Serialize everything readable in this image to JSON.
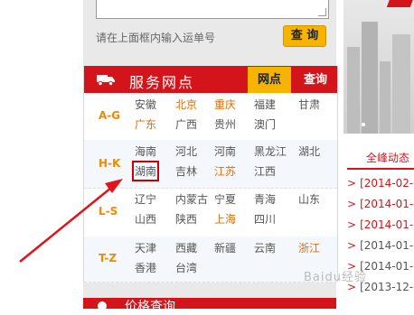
{
  "track": {
    "hint": "请在上面框内输入运单号",
    "query_label": "查 询"
  },
  "outlets": {
    "title": "服务网点",
    "tab_outlets": "网点",
    "tab_query": "查询",
    "groups": [
      {
        "label": "A-G",
        "rows": [
          [
            "安徽",
            "北京",
            "重庆",
            "福建",
            "甘肃"
          ],
          [
            "广东",
            "广西",
            "贵州",
            "澳门"
          ]
        ]
      },
      {
        "label": "H-K",
        "rows": [
          [
            "海南",
            "河北",
            "河南",
            "黑龙江",
            "湖北"
          ],
          [
            "湖南",
            "吉林",
            "江苏",
            "江西"
          ]
        ]
      },
      {
        "label": "L-S",
        "rows": [
          [
            "辽宁",
            "内蒙古",
            "宁夏",
            "青海",
            "山东"
          ],
          [
            "山西",
            "陕西",
            "上海",
            "四川"
          ]
        ]
      },
      {
        "label": "T-Z",
        "rows": [
          [
            "天津",
            "西藏",
            "新疆",
            "云南",
            "浙江"
          ],
          [
            "香港",
            "台湾"
          ]
        ]
      }
    ],
    "orange_cities": [
      "北京",
      "重庆",
      "广东",
      "江苏",
      "上海",
      "浙江"
    ],
    "highlighted_city": "湖南"
  },
  "price": {
    "title": "价格查询"
  },
  "news": {
    "tab_label": "全峰动态",
    "items": [
      {
        "date": "[2014-02-",
        "style": "red"
      },
      {
        "date": "[2014-01-",
        "style": "red"
      },
      {
        "date": "[2014-01-",
        "style": "red"
      },
      {
        "date": "[2014-01-",
        "style": "gray"
      },
      {
        "date": "[2014-01-",
        "style": "gray"
      },
      {
        "date": "[2013-12-",
        "style": "gray"
      }
    ]
  },
  "colors": {
    "brand_red": "#d3151b",
    "accent_yellow": "#f6b400",
    "orange": "#e86c00"
  },
  "watermark": "Baidu经验"
}
